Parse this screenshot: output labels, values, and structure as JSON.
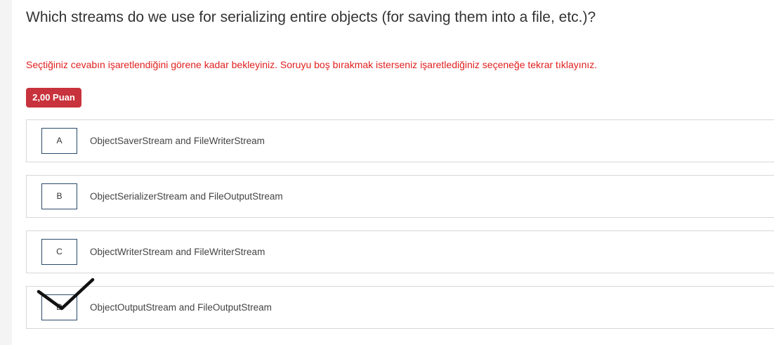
{
  "question": {
    "text": "Which streams do we use for serializing entire objects (for saving them into a file, etc.)?"
  },
  "notice": {
    "text": "Seçtiğiniz cevabın işaretlendiğini görene kadar bekleyiniz. Soruyu boş bırakmak isterseniz işaretlediğiniz seçeneğe tekrar tıklayınız."
  },
  "points": {
    "label": "2,00 Puan"
  },
  "options": [
    {
      "letter": "A",
      "text": "ObjectSaverStream and FileWriterStream"
    },
    {
      "letter": "B",
      "text": "ObjectSerializerStream and FileOutputStream"
    },
    {
      "letter": "C",
      "text": "ObjectWriterStream and FileWriterStream"
    },
    {
      "letter": "D",
      "text": "ObjectOutputStream and FileOutputStream",
      "selected": true
    }
  ],
  "colors": {
    "notice": "#e0201f",
    "badge": "#c8323c",
    "letter_border": "#2b4a6b"
  },
  "icons": {
    "selected_mark": "checkmark-icon"
  }
}
